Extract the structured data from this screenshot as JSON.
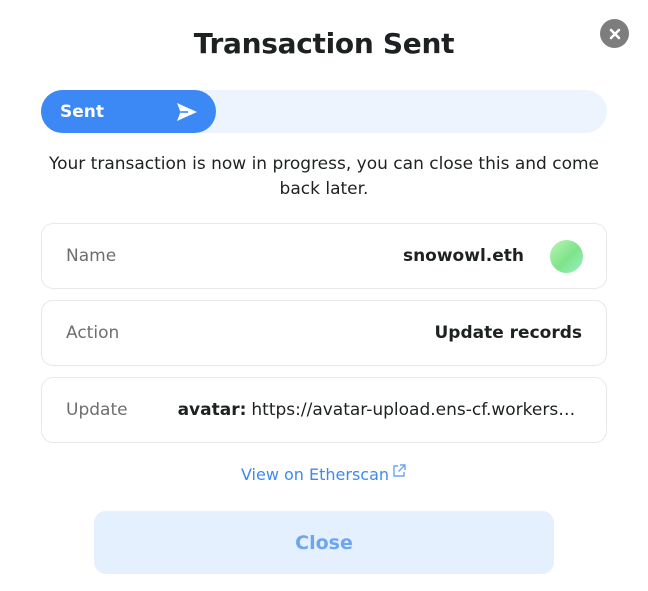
{
  "dialog": {
    "title": "Transaction Sent",
    "close_icon": "close-x-icon"
  },
  "progress": {
    "label": "Sent",
    "icon": "paper-plane-icon",
    "fraction": 0.31,
    "fill_color": "#3c89f5",
    "track_color": "#eef4fe"
  },
  "message": "Your transaction is now in progress, you can close this and come back later.",
  "details": {
    "name": {
      "label": "Name",
      "value": "snowowl.eth"
    },
    "action": {
      "label": "Action",
      "value": "Update records"
    },
    "update": {
      "label": "Update",
      "key": "avatar:",
      "value": "https://avatar-upload.ens-cf.workers...."
    }
  },
  "etherscan": {
    "label": "View on Etherscan",
    "icon": "external-link-icon",
    "color": "#3c89f5"
  },
  "close_button": {
    "label": "Close"
  }
}
